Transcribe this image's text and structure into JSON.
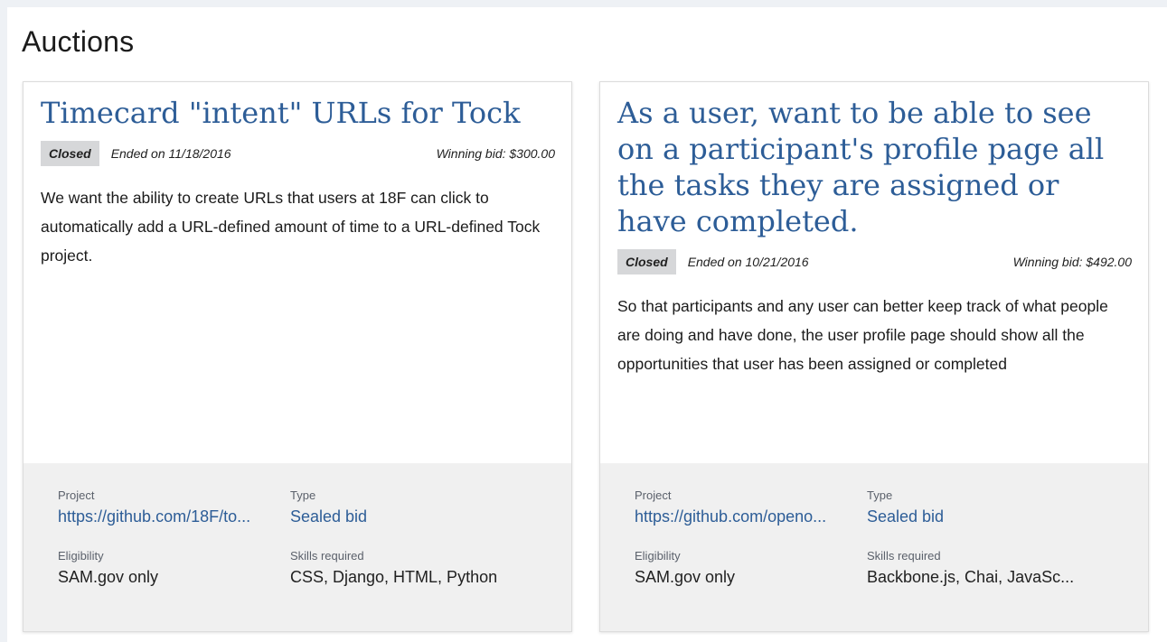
{
  "page": {
    "title": "Auctions"
  },
  "labels": {
    "project": "Project",
    "type": "Type",
    "eligibility": "Eligibility",
    "skills": "Skills required"
  },
  "auctions": [
    {
      "title": "Timecard \"intent\" URLs for Tock",
      "status": "Closed",
      "ended": "Ended on 11/18/2016",
      "winning_bid": "Winning bid: $300.00",
      "description": "We want the ability to create URLs that users at 18F can click to automatically add a URL-defined amount of time to a URL-defined Tock project.",
      "project": "https://github.com/18F/to...",
      "type": "Sealed bid",
      "eligibility": "SAM.gov only",
      "skills": "CSS, Django, HTML, Python"
    },
    {
      "title": "As a user, want to be able to see on a participant's profile page all the tasks they are assigned or have completed.",
      "status": "Closed",
      "ended": "Ended on 10/21/2016",
      "winning_bid": "Winning bid: $492.00",
      "description": "So that participants and any user can better keep track of what people are doing and have done, the user profile page should show all the opportunities that user has been assigned or completed",
      "project": "https://github.com/openo...",
      "type": "Sealed bid",
      "eligibility": "SAM.gov only",
      "skills": "Backbone.js, Chai, JavaSc..."
    }
  ]
}
